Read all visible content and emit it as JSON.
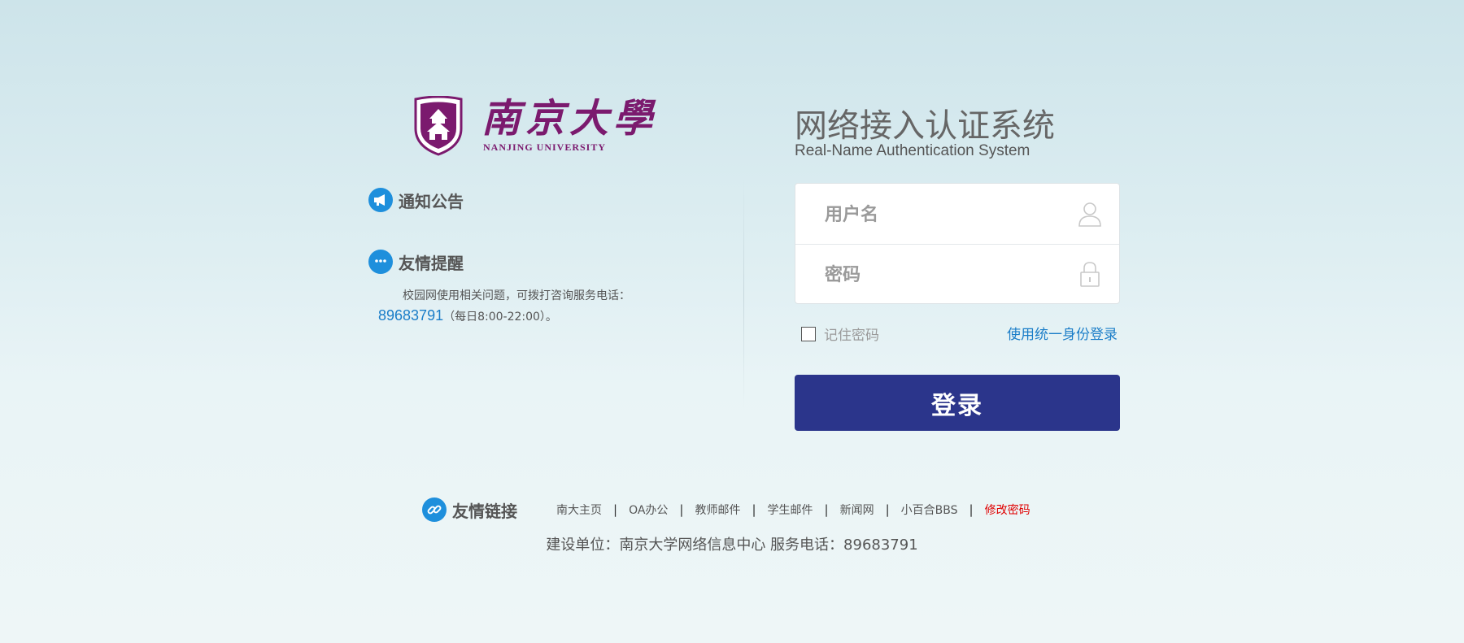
{
  "logo": {
    "cn": "南京大學",
    "en": "NANJING UNIVERSITY"
  },
  "notice": {
    "title": "通知公告"
  },
  "reminder": {
    "title": "友情提醒",
    "text_prefix": "校园网使用相关问题，可拨打咨询服务电话：",
    "phone": "89683791",
    "hours": "（每日8:00-22:00）。"
  },
  "auth": {
    "title": "网络接入认证系统",
    "subtitle": "Real-Name Authentication System",
    "username_placeholder": "用户名",
    "password_placeholder": "密码",
    "remember_label": "记住密码",
    "unified_login": "使用统一身份登录",
    "login_button": "登录"
  },
  "links": {
    "title": "友情链接",
    "items": [
      {
        "label": "南大主页"
      },
      {
        "label": "OA办公"
      },
      {
        "label": "教师邮件"
      },
      {
        "label": "学生邮件"
      },
      {
        "label": "新闻网"
      },
      {
        "label": "小百合BBS"
      },
      {
        "label": "修改密码"
      }
    ]
  },
  "footer": {
    "info": "建设单位：南京大学网络信息中心 服务电话：89683791"
  },
  "colors": {
    "brand_purple": "#7b1a6e",
    "accent_blue": "#1e8fdc",
    "button": "#2b358b",
    "link_red": "#e00000"
  }
}
